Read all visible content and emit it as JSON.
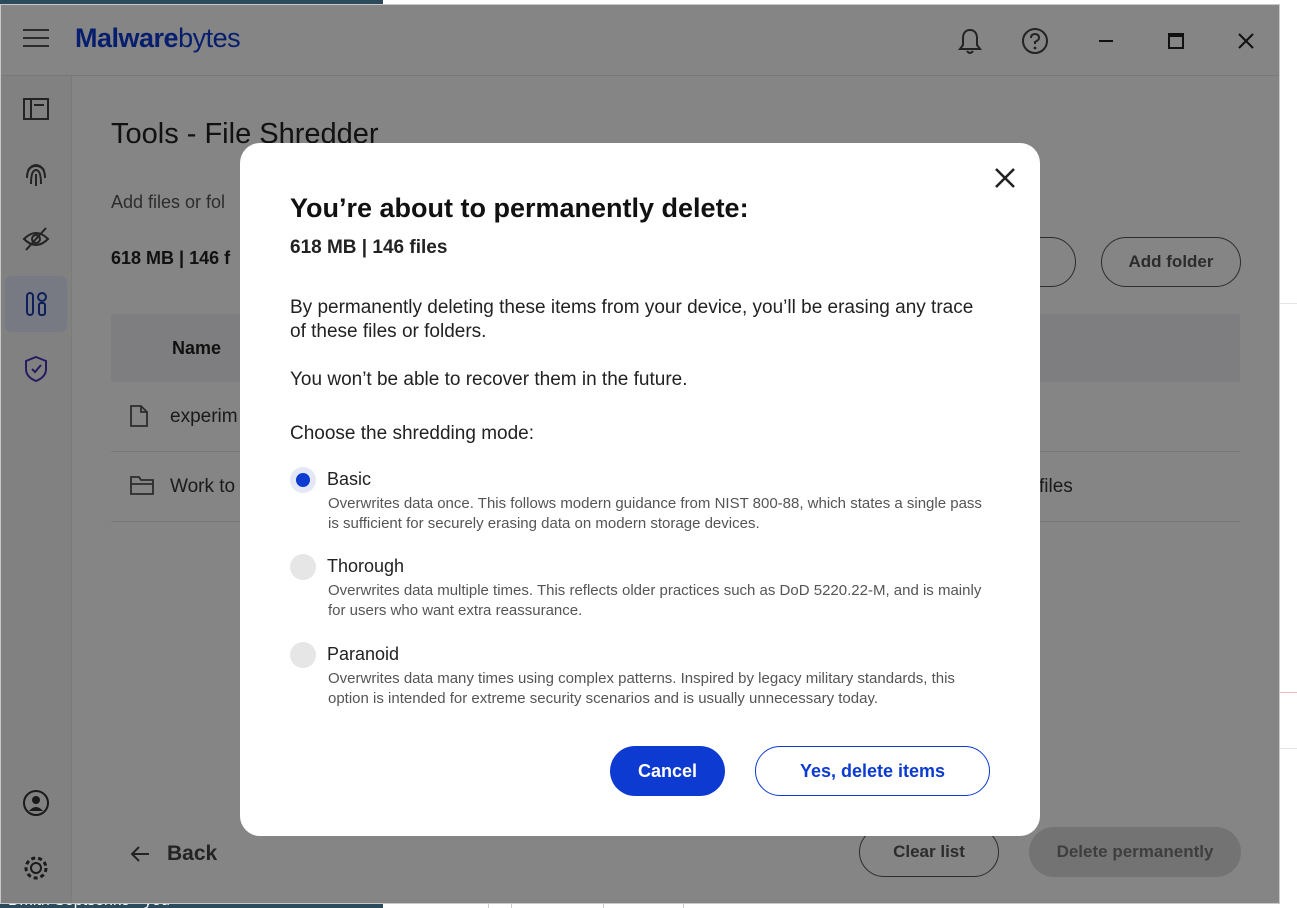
{
  "background": {
    "taskbar_text": "Dmith Soptsenko · you"
  },
  "titlebar": {
    "logo_m": "M",
    "logo_alware": "alware",
    "logo_bytes": "bytes"
  },
  "sidebar": {
    "items": [
      "dashboard-icon",
      "fingerprint-icon",
      "privacy-eye-icon",
      "tools-icon",
      "shield-icon"
    ],
    "bottom": [
      "account-icon",
      "settings-icon"
    ]
  },
  "main": {
    "title": "Tools - File Shredder",
    "subtitle": "Add files or fol",
    "summary": "618 MB | 146 f",
    "add_folder": "Add folder",
    "table_name_header": "Name",
    "rows": [
      {
        "name": "experim",
        "meta": ""
      },
      {
        "name": "Work to",
        "meta": "files"
      }
    ],
    "back": "Back",
    "clear_list": "Clear list",
    "delete_permanently": "Delete permanently"
  },
  "modal": {
    "title": "You’re about to permanently delete:",
    "size": "618 MB | 146 files",
    "paragraph1": "By permanently deleting these items from your device, you’ll be erasing any trace of these files or folders.",
    "paragraph2": "You won’t be able to recover them in the future.",
    "choose": "Choose the shredding mode:",
    "options": [
      {
        "label": "Basic",
        "desc": "Overwrites data once. This follows modern guidance from NIST 800-88, which states a single pass is sufficient for securely erasing data on modern storage devices.",
        "checked": true
      },
      {
        "label": "Thorough",
        "desc": "Overwrites data multiple times. This reflects older practices such as DoD 5220.22-M, and is mainly for users who want extra reassurance.",
        "checked": false
      },
      {
        "label": "Paranoid",
        "desc": "Overwrites data many times using complex patterns. Inspired by legacy military standards, this option is intended for extreme security scenarios and is usually unnecessary today.",
        "checked": false
      }
    ],
    "cancel": "Cancel",
    "confirm": "Yes, delete items"
  },
  "colors": {
    "brand": "#0d3bd1",
    "overlay": "rgba(0,0,0,0.48)"
  }
}
